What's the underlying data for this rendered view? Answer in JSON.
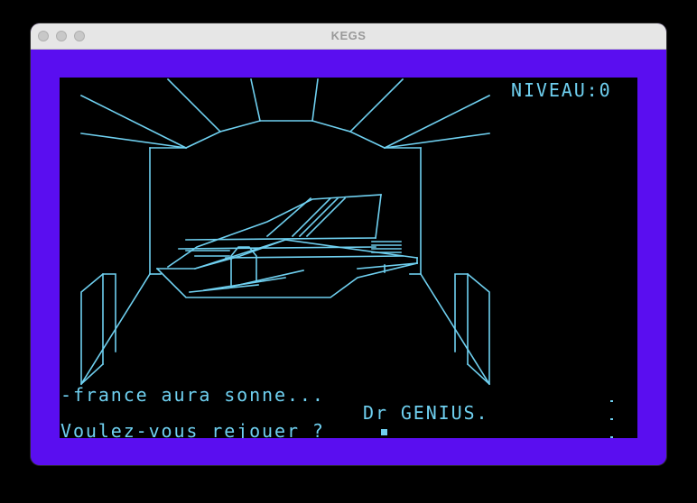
{
  "window": {
    "title": "KEGS"
  },
  "game": {
    "level_text": "NIVEAU:0",
    "line1": "-france aura sonne...",
    "line2": "Dr GENIUS.",
    "prompt": "Voulez-vous rejouer ? "
  },
  "colors": {
    "border": "#5a0ef0",
    "screen": "#000000",
    "ink": "#6fd0f0"
  }
}
